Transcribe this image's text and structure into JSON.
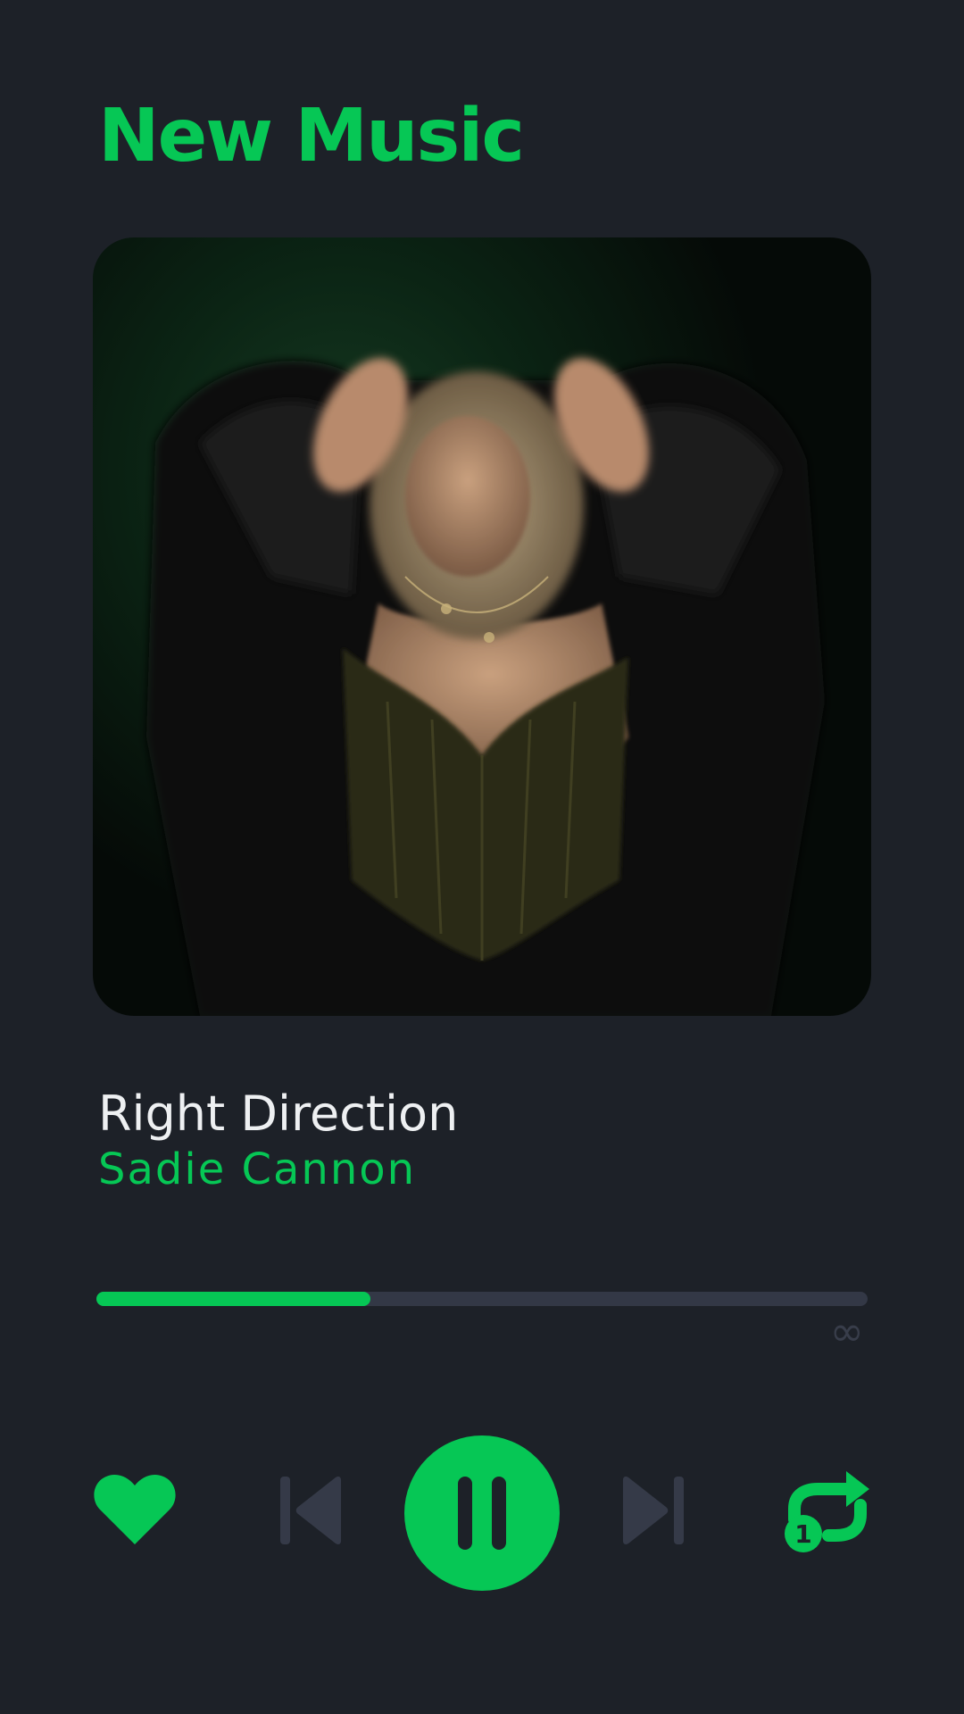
{
  "header": {
    "title": "New Music"
  },
  "album": {
    "art_description_icon": "album-cover-photo"
  },
  "track": {
    "title": "Right Direction",
    "artist": "Sadie Cannon"
  },
  "progress": {
    "fraction": 0.355,
    "duration_text": "∞"
  },
  "controls": {
    "like": {
      "icon": "heart-icon",
      "active": true
    },
    "previous": {
      "icon": "skip-previous-icon"
    },
    "play_pause": {
      "icon": "pause-icon",
      "state": "playing"
    },
    "next": {
      "icon": "skip-next-icon"
    },
    "repeat": {
      "icon": "repeat-one-icon",
      "badge": "1",
      "active": true
    }
  },
  "colors": {
    "background": "#1d2128",
    "accent": "#06c755",
    "text_primary": "#eef0f2",
    "control_muted": "#353a48",
    "track": "#333846"
  }
}
